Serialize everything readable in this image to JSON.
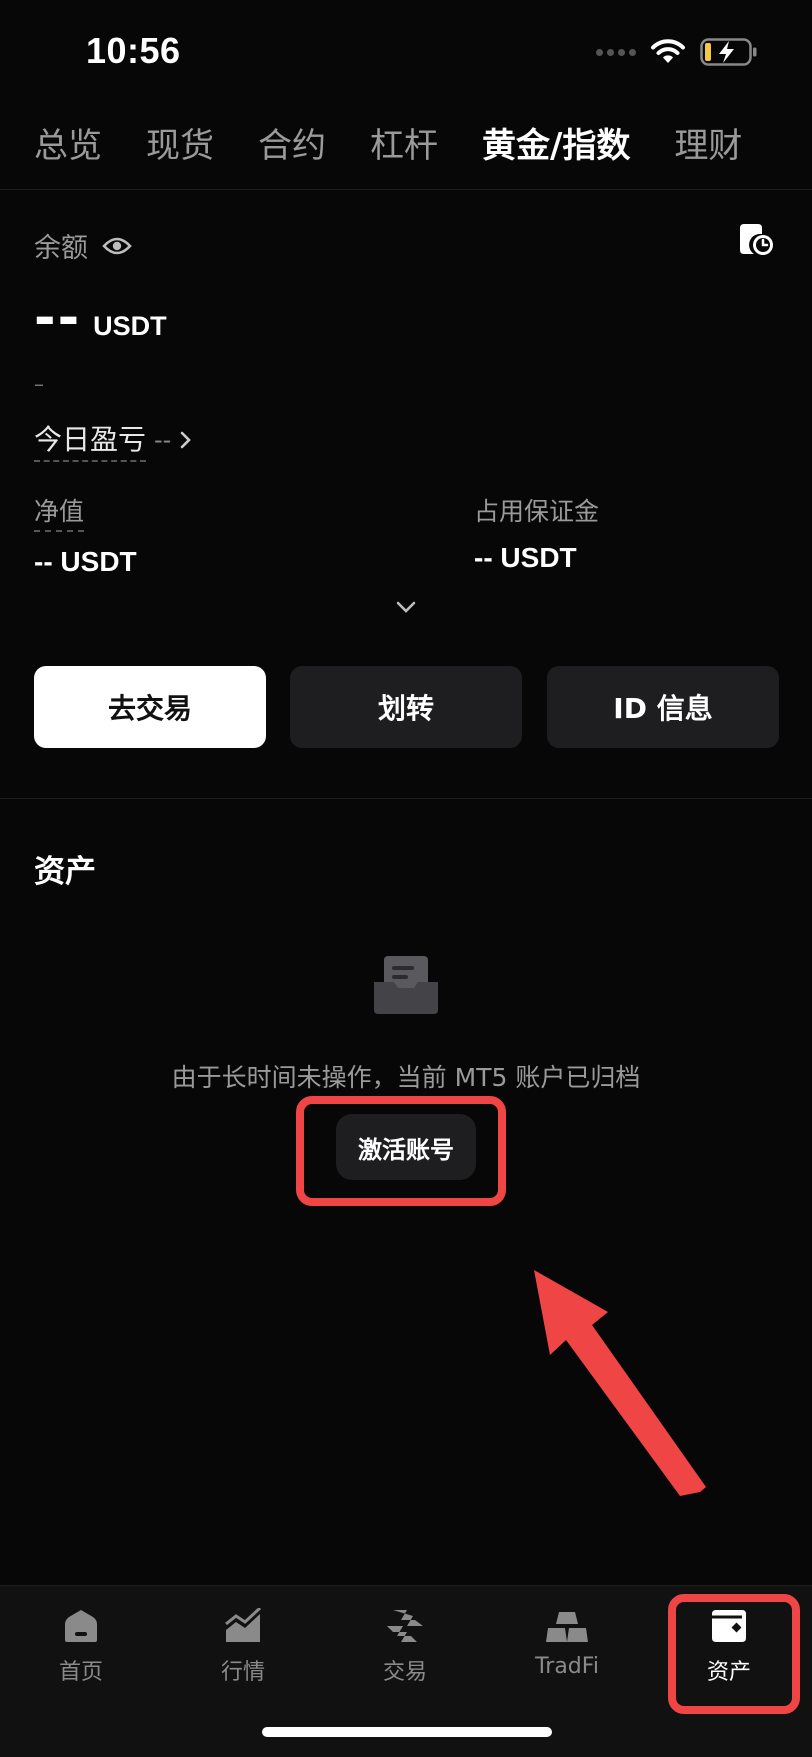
{
  "status_bar": {
    "time": "10:56"
  },
  "top_tabs": [
    {
      "label": "总览",
      "active": false
    },
    {
      "label": "现货",
      "active": false
    },
    {
      "label": "合约",
      "active": false
    },
    {
      "label": "杠杆",
      "active": false
    },
    {
      "label": "黄金/指数",
      "active": true
    },
    {
      "label": "理财",
      "active": false
    }
  ],
  "balance": {
    "label": "余额",
    "value": "--",
    "unit": "USDT",
    "sub_value": "–",
    "pnl_label": "今日盈亏",
    "pnl_value": "--"
  },
  "stats": {
    "net_value": {
      "label": "净值",
      "value": "-- USDT"
    },
    "margin_used": {
      "label": "占用保证金",
      "value": "-- USDT"
    }
  },
  "actions": {
    "trade": "去交易",
    "transfer": "划转",
    "id_info": "ID 信息"
  },
  "assets": {
    "title": "资产",
    "empty_message": "由于长时间未操作，当前 MT5 账户已归档",
    "activate_button": "激活账号"
  },
  "bottom_nav": [
    {
      "label": "首页",
      "icon": "home-icon",
      "active": false
    },
    {
      "label": "行情",
      "icon": "market-chart-icon",
      "active": false
    },
    {
      "label": "交易",
      "icon": "trade-exchange-icon",
      "active": false
    },
    {
      "label": "TradFi",
      "icon": "gold-bars-icon",
      "active": false
    },
    {
      "label": "资产",
      "icon": "wallet-icon",
      "active": true
    }
  ],
  "colors": {
    "background": "#070707",
    "annotation_red": "#f04545",
    "secondary_button": "#1e1e20"
  }
}
